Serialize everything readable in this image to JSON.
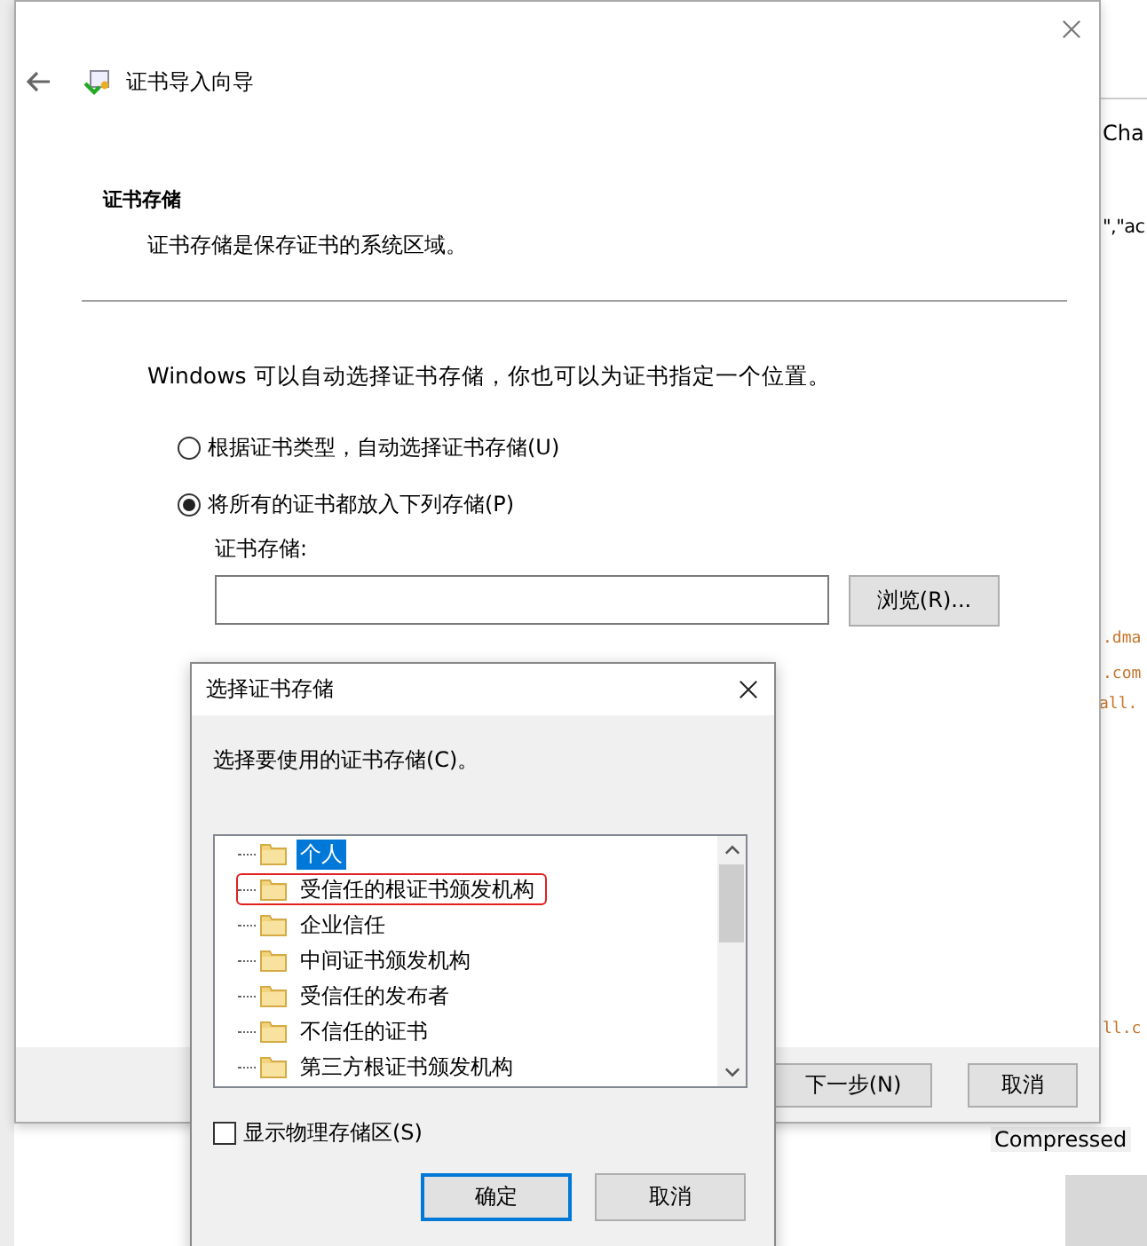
{
  "background_window": {
    "fragments": [
      {
        "text": "Cha"
      },
      {
        "text": "\",\"ac"
      },
      {
        "text": ".dma"
      },
      {
        "text": ".com"
      },
      {
        "text": "all."
      },
      {
        "text": "ll.c"
      },
      {
        "text": "Compressed"
      }
    ]
  },
  "wizard": {
    "title": "证书导入向导",
    "heading": "证书存储",
    "subheading": "证书存储是保存证书的系统区域。",
    "intro": "Windows 可以自动选择证书存储，你也可以为证书指定一个位置。",
    "options": [
      {
        "label": "根据证书类型，自动选择证书存储(U)",
        "selected": false
      },
      {
        "label": "将所有的证书都放入下列存储(P)",
        "selected": true
      }
    ],
    "store_label": "证书存储:",
    "browse_button": "浏览(R)...",
    "buttons": [
      "下一步(N)",
      "取消"
    ]
  },
  "store_dialog": {
    "title": "选择证书存储",
    "prompt": "选择要使用的证书存储(C)。",
    "stores": [
      {
        "label": "个人",
        "selected": true,
        "annotated": false
      },
      {
        "label": "受信任的根证书颁发机构",
        "selected": false,
        "annotated": true
      },
      {
        "label": "企业信任",
        "selected": false,
        "annotated": false
      },
      {
        "label": "中间证书颁发机构",
        "selected": false,
        "annotated": false
      },
      {
        "label": "受信任的发布者",
        "selected": false,
        "annotated": false
      },
      {
        "label": "不信任的证书",
        "selected": false,
        "annotated": false
      },
      {
        "label": "第三方根证书颁发机构",
        "selected": false,
        "annotated": false
      }
    ],
    "show_physical": {
      "label": "显示物理存储区(S)",
      "checked": false
    },
    "buttons": [
      {
        "label": "确定",
        "default": true
      },
      {
        "label": "取消",
        "default": false
      }
    ]
  }
}
